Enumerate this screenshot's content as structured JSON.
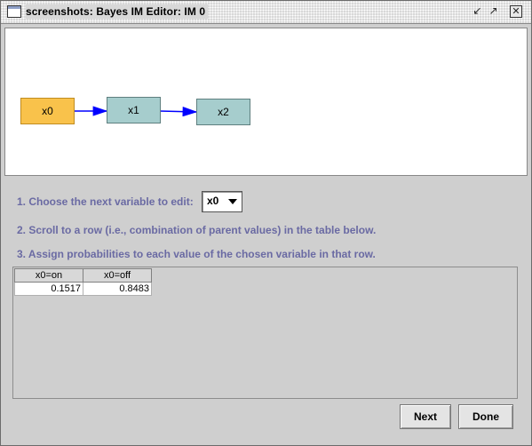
{
  "window": {
    "title": "screenshots: Bayes IM Editor: IM 0"
  },
  "graph": {
    "nodes": [
      {
        "label": "x0",
        "color": "#f9c24b"
      },
      {
        "label": "x1",
        "color": "#a6cdcd"
      },
      {
        "label": "x2",
        "color": "#a6cdcd"
      }
    ],
    "edge_color": "#0000ff"
  },
  "instructions": {
    "step1": "1.  Choose the next variable to edit:",
    "step2": "2.  Scroll to a row (i.e., combination of parent values) in the table below.",
    "step3": "3.  Assign probabilities to each value of the chosen variable in that row."
  },
  "variable_select": {
    "selected": "x0"
  },
  "table": {
    "columns": [
      "x0=on",
      "x0=off"
    ],
    "rows": [
      [
        "0.1517",
        "0.8483"
      ]
    ]
  },
  "buttons": {
    "next": "Next",
    "done": "Done"
  }
}
